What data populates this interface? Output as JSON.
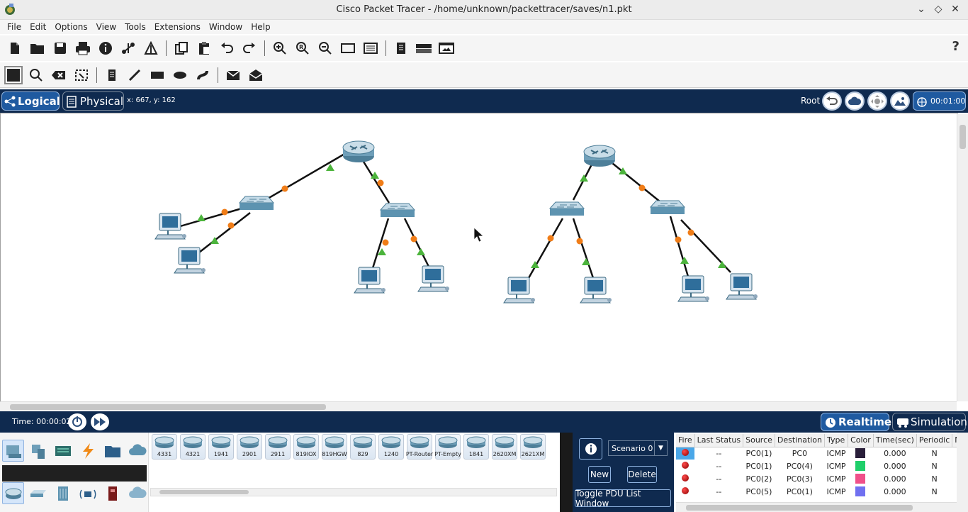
{
  "window": {
    "title": "Cisco Packet Tracer - /home/unknown/packettracer/saves/n1.pkt"
  },
  "menu": [
    "File",
    "Edit",
    "Options",
    "View",
    "Tools",
    "Extensions",
    "Window",
    "Help"
  ],
  "workspace": {
    "logical_label": "Logical",
    "physical_label": "Physical",
    "cursor_coords": "x: 667, y: 162",
    "root_label": "Root",
    "clock": "00:01:00"
  },
  "timebar": {
    "time": "Time: 00:00:02",
    "realtime_label": "Realtime",
    "simulation_label": "Simulation"
  },
  "devices": [
    "4331",
    "4321",
    "1941",
    "2901",
    "2911",
    "819IOX",
    "819HGW",
    "829",
    "1240",
    "PT-Router",
    "PT-Empty",
    "1841",
    "2620XM",
    "2621XM"
  ],
  "pdu_controls": {
    "scenario": "Scenario 0",
    "new_label": "New",
    "delete_label": "Delete",
    "toggle_label": "Toggle PDU List Window"
  },
  "pdu_table": {
    "headers": [
      "Fire",
      "Last Status",
      "Source",
      "Destination",
      "Type",
      "Color",
      "Time(sec)",
      "Periodic",
      "N"
    ],
    "rows": [
      {
        "last_status": "--",
        "source": "PC0(1)",
        "destination": "PC0",
        "type": "ICMP",
        "color": "#2a1f3a",
        "time": "0.000",
        "periodic": "N"
      },
      {
        "last_status": "--",
        "source": "PC0(1)",
        "destination": "PC0(4)",
        "type": "ICMP",
        "color": "#1fcf6a",
        "time": "0.000",
        "periodic": "N"
      },
      {
        "last_status": "--",
        "source": "PC0(2)",
        "destination": "PC0(3)",
        "type": "ICMP",
        "color": "#f0508a",
        "time": "0.000",
        "periodic": "N"
      },
      {
        "last_status": "--",
        "source": "PC0(5)",
        "destination": "PC0(1)",
        "type": "ICMP",
        "color": "#7070f0",
        "time": "0.000",
        "periodic": "N"
      }
    ]
  },
  "colors": {
    "bar_dark": "#0f2a4f",
    "accent_blue": "#1f5aa0",
    "link_up": "#4cb43c",
    "link_pending": "#f07d18"
  }
}
